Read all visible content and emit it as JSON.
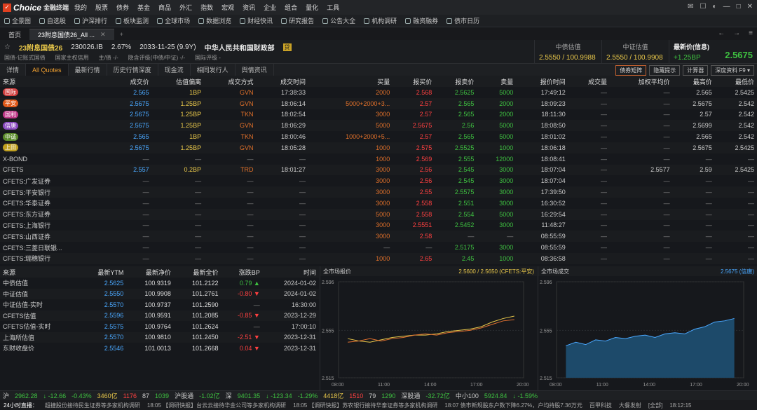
{
  "app": {
    "logo": "Choice",
    "logo_sub": "金融终端"
  },
  "menu": [
    "我的",
    "股票",
    "债券",
    "基金",
    "商品",
    "外汇",
    "指数",
    "宏观",
    "资讯",
    "企业",
    "组合",
    "量化",
    "工具"
  ],
  "toolbar": [
    "全景图",
    "自选股",
    "沪深排行",
    "板块监测",
    "全球市场",
    "数据浏览",
    "财经快讯",
    "研究报告",
    "公告大全",
    "机构调研",
    "融资融券",
    "债市日历"
  ],
  "tabs": {
    "home": "首页",
    "active": "23附息国债26_All ..."
  },
  "bond": {
    "name": "23附息国债26",
    "code": "230026.IB",
    "coupon": "2.67%",
    "maturity": "2033-11-25 (9.9Y)",
    "issuer": "中华人民共和国财政部",
    "badge": "贷",
    "meta": [
      "国债-记账式国债",
      "国家主权信用",
      "主/债 -/-",
      "隐含评级(中债/中证) -/-",
      "国际评级 -"
    ]
  },
  "quotes_head": {
    "zhongzhai": {
      "label": "中债估值",
      "value": "2.5550 / 100.9988"
    },
    "zhongzheng": {
      "label": "中证估值",
      "value": "2.5550 / 100.9908"
    },
    "last": {
      "label": "最新价(信息)",
      "chg": "+1.25BP",
      "price": "2.5675"
    }
  },
  "subtabs": [
    "详情",
    "All Quotes",
    "最新行情",
    "历史行情深度",
    "现金流",
    "相同发行人",
    "舆情资讯"
  ],
  "right_buttons": [
    "债券矩阵",
    "隐藏提示",
    "计算器",
    "深度资料 F9 ▾"
  ],
  "main_table": {
    "headers": [
      "来源",
      "成交价",
      "估值偏离",
      "成交方式",
      "成交时间",
      "买量",
      "报买价",
      "报卖价",
      "卖量",
      "报价时间",
      "成交量",
      "加权平均价",
      "最高价",
      "最低价"
    ],
    "rows": [
      {
        "src": "国际",
        "tag": "#d04040",
        "c": [
          "2.565",
          "1BP",
          "GVN",
          "17:38:33",
          "2000",
          "2.568",
          "2.5625",
          "5000",
          "17:49:12",
          "—",
          "—",
          "2.565",
          "2.5425"
        ]
      },
      {
        "src": "平安",
        "tag": "#e05a1a",
        "c": [
          "2.5675",
          "1.25BP",
          "GVN",
          "18:06:14",
          "5000+2000+3...",
          "2.57",
          "2.565",
          "2000",
          "18:09:23",
          "—",
          "—",
          "2.5675",
          "2.542"
        ]
      },
      {
        "src": "国利",
        "tag": "#c03a8a",
        "c": [
          "2.5675",
          "1.25BP",
          "TKN",
          "18:02:54",
          "3000",
          "2.57",
          "2.565",
          "2000",
          "18:11:30",
          "—",
          "—",
          "2.57",
          "2.542"
        ]
      },
      {
        "src": "信唐",
        "tag": "#8a4ac0",
        "c": [
          "2.5675",
          "1.25BP",
          "GVN",
          "18:06:29",
          "5000",
          "2.5675",
          "2.56",
          "5000",
          "18:08:50",
          "—",
          "—",
          "2.5699",
          "2.542"
        ]
      },
      {
        "src": "中诚",
        "tag": "#5a8a2a",
        "c": [
          "2.565",
          "1BP",
          "TKN",
          "18:00:46",
          "1000+2000+5...",
          "2.57",
          "2.565",
          "5000",
          "18:01:02",
          "—",
          "—",
          "2.565",
          "2.542"
        ]
      },
      {
        "src": "上田",
        "tag": "#c0a020",
        "c": [
          "2.5675",
          "1.25BP",
          "GVN",
          "18:05:28",
          "1000",
          "2.575",
          "2.5525",
          "1000",
          "18:06:18",
          "—",
          "—",
          "2.5675",
          "2.5425"
        ]
      },
      {
        "src": "X-BOND",
        "tag": "",
        "c": [
          "—",
          "—",
          "—",
          "—",
          "1000",
          "2.569",
          "2.555",
          "12000",
          "18:08:41",
          "—",
          "—",
          "—",
          "—"
        ]
      },
      {
        "src": "CFETS",
        "tag": "",
        "c": [
          "2.557",
          "0.2BP",
          "TRD",
          "18:01:27",
          "3000",
          "2.56",
          "2.545",
          "3000",
          "18:07:04",
          "—",
          "2.5577",
          "2.59",
          "2.5425"
        ]
      },
      {
        "src": "CFETS:广发证券",
        "tag": "",
        "c": [
          "—",
          "—",
          "—",
          "—",
          "3000",
          "2.56",
          "2.545",
          "3000",
          "18:07:04",
          "—",
          "—",
          "—",
          "—"
        ]
      },
      {
        "src": "CFETS:平安银行",
        "tag": "",
        "c": [
          "—",
          "—",
          "—",
          "—",
          "3000",
          "2.55",
          "2.5575",
          "3000",
          "17:39:50",
          "—",
          "—",
          "—",
          "—"
        ]
      },
      {
        "src": "CFETS:华泰证券",
        "tag": "",
        "c": [
          "—",
          "—",
          "—",
          "—",
          "3000",
          "2.558",
          "2.551",
          "3000",
          "16:30:52",
          "—",
          "—",
          "—",
          "—"
        ]
      },
      {
        "src": "CFETS:东方证券",
        "tag": "",
        "c": [
          "—",
          "—",
          "—",
          "—",
          "5000",
          "2.558",
          "2.554",
          "5000",
          "16:29:54",
          "—",
          "—",
          "—",
          "—"
        ]
      },
      {
        "src": "CFETS:上海银行",
        "tag": "",
        "c": [
          "—",
          "—",
          "—",
          "—",
          "3000",
          "2.5551",
          "2.5452",
          "3000",
          "11:48:27",
          "—",
          "—",
          "—",
          "—"
        ]
      },
      {
        "src": "CFETS:山西证券",
        "tag": "",
        "c": [
          "—",
          "—",
          "—",
          "—",
          "3000",
          "2.58",
          "—",
          "—",
          "08:55:59",
          "—",
          "—",
          "—",
          "—"
        ]
      },
      {
        "src": "CFETS:三菱日联银...",
        "tag": "",
        "c": [
          "—",
          "—",
          "—",
          "—",
          "—",
          "—",
          "2.5175",
          "3000",
          "08:55:59",
          "—",
          "—",
          "—",
          "—"
        ]
      },
      {
        "src": "CFETS:瑞穗银行",
        "tag": "",
        "c": [
          "—",
          "—",
          "—",
          "—",
          "1000",
          "2.65",
          "2.45",
          "1000",
          "08:36:58",
          "—",
          "—",
          "—",
          "—"
        ]
      }
    ]
  },
  "val_table": {
    "headers": [
      "来源",
      "最新YTM",
      "最新净价",
      "最新全价",
      "涨跌BP",
      "时间"
    ],
    "rows": [
      {
        "c": [
          "中债估值",
          "2.5625",
          "100.9319",
          "101.2122",
          "0.79 ▲",
          "2024-01-02"
        ],
        "dir": "up"
      },
      {
        "c": [
          "中证估值",
          "2.5550",
          "100.9908",
          "101.2761",
          "-0.80 ▼",
          "2024-01-02"
        ],
        "dir": "down"
      },
      {
        "c": [
          "中证估值-实时",
          "2.5570",
          "100.9737",
          "101.2590",
          "—",
          "16:30:00"
        ],
        "dir": "none"
      },
      {
        "c": [
          "CFETS估值",
          "2.5596",
          "100.9591",
          "101.2085",
          "-0.85 ▼",
          "2023-12-29"
        ],
        "dir": "down"
      },
      {
        "c": [
          "CFETS估值-实时",
          "2.5575",
          "100.9764",
          "101.2624",
          "—",
          "17:00:10"
        ],
        "dir": "none"
      },
      {
        "c": [
          "上海所估值",
          "2.5570",
          "100.9810",
          "101.2450",
          "-2.51 ▼",
          "2023-12-31"
        ],
        "dir": "down"
      },
      {
        "c": [
          "东财收盘价",
          "2.5546",
          "101.0013",
          "101.2668",
          "0.04 ▼",
          "2023-12-31"
        ],
        "dir": "down"
      }
    ]
  },
  "chart_left": {
    "title": "全市场报价",
    "right": "2.5600 / 2.5650 (CFETS:平安)",
    "chart_data": {
      "type": "line",
      "ylim": [
        2.515,
        2.596
      ],
      "yticks": [
        "2.596",
        "2.555",
        "2.515"
      ],
      "xticks": [
        "08:00",
        "11:00",
        "14:00",
        "17:00",
        "20:00"
      ],
      "series": [
        {
          "values": [
            2.548,
            2.546,
            2.545,
            2.547,
            2.549,
            2.55,
            2.551,
            2.551,
            2.552,
            2.554,
            2.555,
            2.556,
            2.558,
            2.562,
            2.565,
            2.567
          ]
        },
        {
          "values": [
            2.545,
            2.546,
            2.548,
            2.546,
            2.548,
            2.549,
            2.551,
            2.552,
            2.551,
            2.553,
            2.554,
            2.555,
            2.557,
            2.56,
            2.563,
            2.564
          ]
        }
      ]
    }
  },
  "chart_right": {
    "title": "全市场成交",
    "right": "2.5675 (信唐)",
    "chart_data": {
      "type": "area",
      "ylim": [
        2.515,
        2.596
      ],
      "yticks": [
        "2.596",
        "2.555",
        "2.515"
      ],
      "xticks": [
        "08:00",
        "11:00",
        "14:00",
        "17:00",
        "20:00"
      ],
      "values": [
        2.542,
        2.545,
        2.543,
        2.547,
        2.546,
        2.549,
        2.548,
        2.55,
        2.551,
        2.549,
        2.552,
        2.553,
        2.552,
        2.556,
        2.558,
        2.562,
        2.563,
        2.565
      ]
    }
  },
  "status": [
    {
      "t": "沪",
      "c": "#ccc"
    },
    {
      "t": "2962.28",
      "c": "#3ec040"
    },
    {
      "t": "↓ -12.66",
      "c": "#3ec040"
    },
    {
      "t": "-0.43%",
      "c": "#3ec040"
    },
    {
      "t": "3460亿",
      "c": "#e8c74a"
    },
    {
      "t": "1176",
      "c": "#ff4040"
    },
    {
      "t": "87",
      "c": "#ccc"
    },
    {
      "t": "1039",
      "c": "#3ec040"
    },
    {
      "t": "沪股通",
      "c": "#ccc"
    },
    {
      "t": "-1.02亿",
      "c": "#3ec040"
    },
    {
      "t": "深",
      "c": "#ccc"
    },
    {
      "t": "9401.35",
      "c": "#3ec040"
    },
    {
      "t": "↓ -123.34",
      "c": "#3ec040"
    },
    {
      "t": "-1.29%",
      "c": "#3ec040"
    },
    {
      "t": "4418亿",
      "c": "#e8c74a"
    },
    {
      "t": "1510",
      "c": "#ff4040"
    },
    {
      "t": "79",
      "c": "#ccc"
    },
    {
      "t": "1290",
      "c": "#3ec040"
    },
    {
      "t": "深股通",
      "c": "#ccc"
    },
    {
      "t": "-32.72亿",
      "c": "#3ec040"
    },
    {
      "t": "中小100",
      "c": "#ccc"
    },
    {
      "t": "5924.84",
      "c": "#3ec040"
    },
    {
      "t": "↓ -1.59%",
      "c": "#3ec040"
    }
  ],
  "news": [
    "24小时直播：",
    "超捷股份接待民生证券等多家机构调研",
    "18:05 【调研快报】台云云接待华金公司等多家机构调研",
    "18:05 【调研快报】苏农银行接待华泰证券等多家机构调研",
    "18:07 债市新规股东户数下降6.27%，户均持股7.36万元",
    "百甲科技",
    "大餐发射",
    "[全部]",
    "18:12:15"
  ]
}
